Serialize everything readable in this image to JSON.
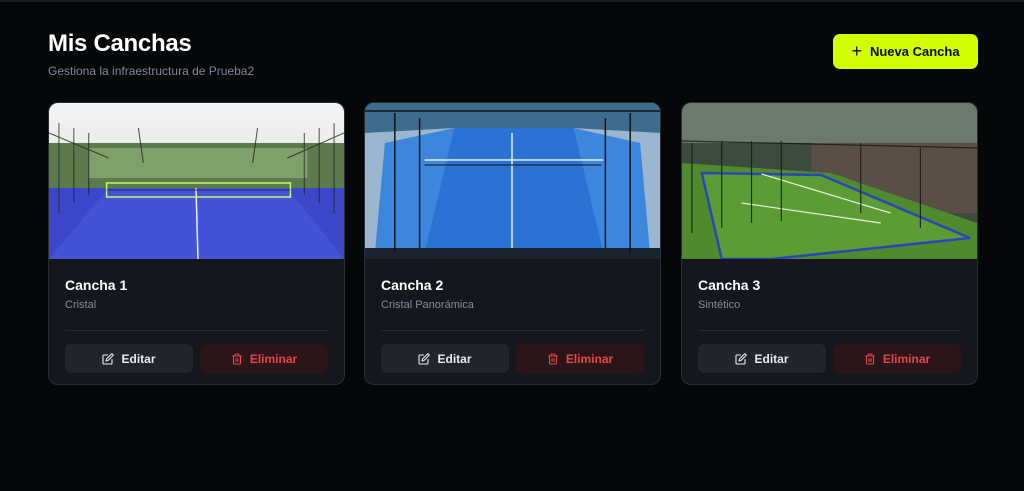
{
  "header": {
    "title": "Mis Canchas",
    "subtitle": "Gestiona la infraestructura de Prueba2",
    "new_button_label": "Nueva Cancha"
  },
  "colors": {
    "accent": "#d4ff00",
    "danger": "#e2464f",
    "background": "#060709",
    "card": "#15171c"
  },
  "courts": [
    {
      "name": "Cancha 1",
      "type": "Cristal",
      "edit_label": "Editar",
      "delete_label": "Eliminar",
      "image": "blue-outdoor-court-photo"
    },
    {
      "name": "Cancha 2",
      "type": "Cristal Panorámica",
      "edit_label": "Editar",
      "delete_label": "Eliminar",
      "image": "blue-panoramic-court-photo"
    },
    {
      "name": "Cancha 3",
      "type": "Sintético",
      "edit_label": "Editar",
      "delete_label": "Eliminar",
      "image": "green-indoor-court-photo"
    }
  ],
  "icons": {
    "new": "plus-icon",
    "edit": "edit-icon",
    "delete": "trash-icon"
  }
}
